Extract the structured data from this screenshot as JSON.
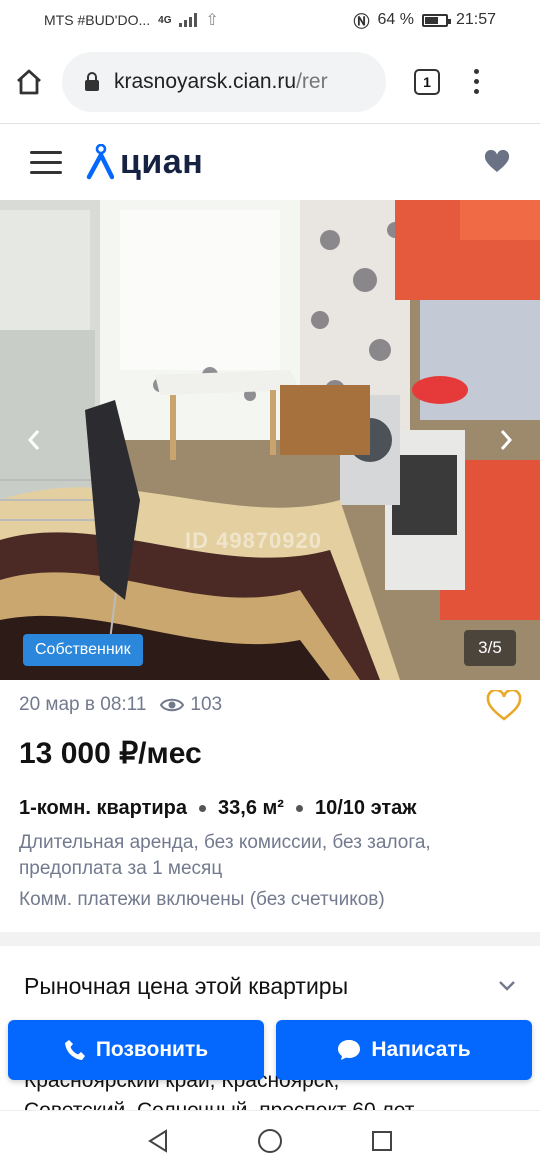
{
  "status_bar": {
    "carrier": "MTS #BUD'DO...",
    "network": "4G",
    "battery": "64 %",
    "battery_level": 0.64,
    "time": "21:57"
  },
  "browser": {
    "url_domain": "krasnoyarsk.cian.ru",
    "url_rest": "/rer",
    "tab_count": "1"
  },
  "site": {
    "logo_text": "циан"
  },
  "gallery": {
    "badge": "Собственник",
    "counter": "3/5",
    "watermark": "ID 49870920"
  },
  "listing": {
    "date": "20 мар в 08:11",
    "views": "103",
    "price": "13 000 ₽/мес",
    "rooms": "1-комн. квартира",
    "area": "33,6 м²",
    "floor": "10/10 этаж",
    "terms": "Длительная аренда, без комиссии, без залога, предоплата за 1 месяц",
    "utilities": "Комм. платежи включены (без счетчиков)"
  },
  "market": {
    "title": "Рыночная цена этой квартиры"
  },
  "address": {
    "line1": "Красноярский край, Красноярск,",
    "line2": "Советский, Солнечный, проспект 60 лет"
  },
  "actions": {
    "call_label": "Позвонить",
    "message_label": "Написать"
  },
  "colors": {
    "accent": "#0468ff",
    "badge": "#2b87db",
    "fav": "#e8a92a"
  }
}
